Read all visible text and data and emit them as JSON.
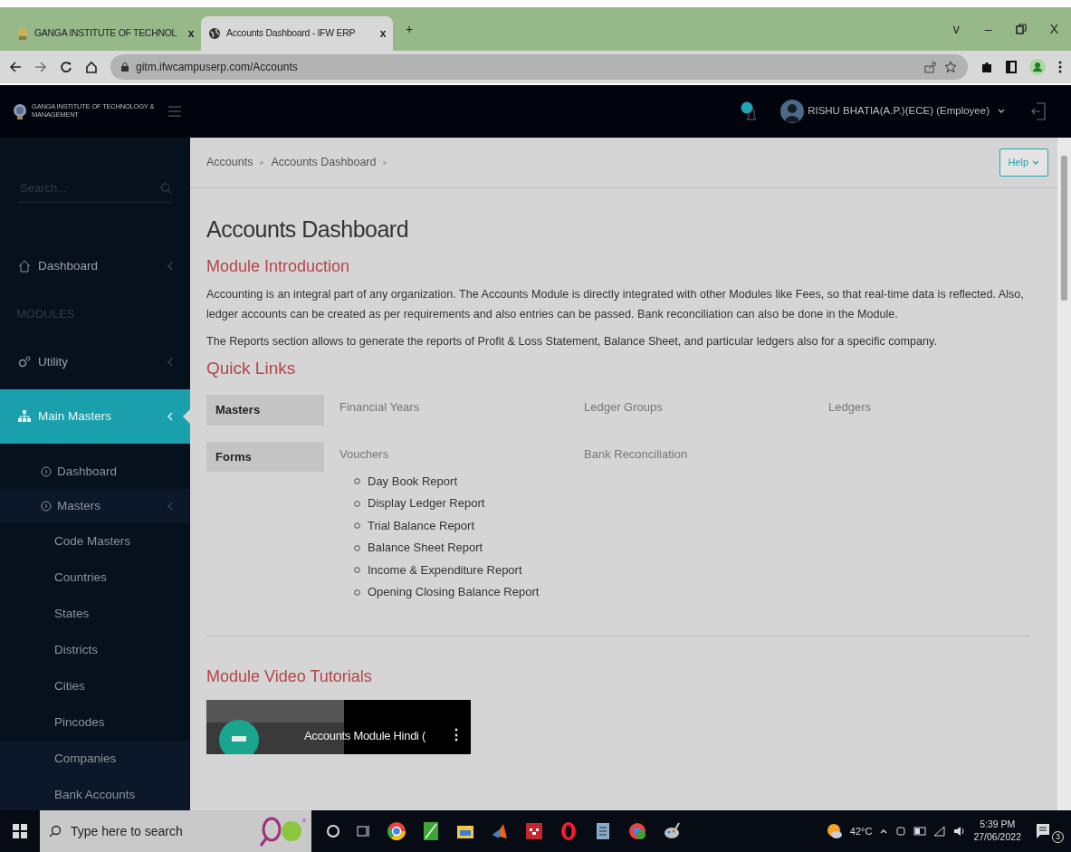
{
  "browser": {
    "tabs": [
      {
        "title": "GANGA INSTITUTE OF TECHNOL",
        "close": "x",
        "selected": false
      },
      {
        "title": "Accounts Dashboard - IFW ERP",
        "close": "x",
        "selected": true
      }
    ],
    "new_tab": "+",
    "window_controls": {
      "menu": "v",
      "minimize": "–",
      "close": "X"
    },
    "url": "gitm.ifwcampuserp.com/Accounts"
  },
  "header": {
    "logo_text": "GANGA INSTITUTE OF TECHNOLOGY & MANAGEMENT",
    "user": "RISHU BHATIA(A.P.)(ECE) (Employee)"
  },
  "sidebar": {
    "search": {
      "placeholder": "Search..."
    },
    "items": [
      {
        "kind": "nav",
        "label": "Dashboard",
        "selected": false
      },
      {
        "kind": "header",
        "label": "MODULES"
      },
      {
        "kind": "nav",
        "label": "Utility",
        "selected": false
      },
      {
        "kind": "nav",
        "label": "Main Masters",
        "selected": true,
        "children": [
          {
            "label": "Dashboard",
            "highlighted": false
          },
          {
            "label": "Masters",
            "highlighted": true,
            "children": [
              {
                "label": "Code Masters",
                "highlighted": false
              },
              {
                "label": "Countries",
                "highlighted": false
              },
              {
                "label": "States",
                "highlighted": false
              },
              {
                "label": "Districts",
                "highlighted": false
              },
              {
                "label": "Cities",
                "highlighted": false
              },
              {
                "label": "Pincodes",
                "highlighted": false
              },
              {
                "label": "Companies",
                "highlighted": true
              },
              {
                "label": "Bank Accounts",
                "highlighted": true
              }
            ]
          }
        ]
      }
    ]
  },
  "breadcrumb": [
    "Accounts",
    "Accounts Dashboard"
  ],
  "help_button": "Help",
  "page_title": "Accounts Dashboard",
  "sections": [
    {
      "heading": "Module Introduction",
      "paragraphs": [
        "Accounting is an integral part of any organization. The Accounts Module is directly integrated with other Modules like Fees, so that real-time data is reflected. Also, ledger accounts can be created as per requirements and also entries can be passed. Bank reconciliation can also be done in the Module.",
        "The Reports section allows to generate the reports of Profit & Loss Statement, Balance Sheet, and particular ledgers also for a specific company."
      ]
    }
  ],
  "quick_links": {
    "heading": "Quick Links",
    "rows": [
      {
        "label": "Masters",
        "links": [
          {
            "label": "Financial Years"
          },
          {
            "label": "Ledger Groups"
          },
          {
            "label": "Ledgers"
          }
        ]
      },
      {
        "label": "Forms",
        "links": [
          {
            "label": "Vouchers",
            "children": [
              "Day Book Report",
              "Display Ledger Report",
              "Trial Balance Report",
              "Balance Sheet Report",
              "Income & Expenditure Report",
              "Opening Closing Balance Report"
            ]
          },
          {
            "label": "Bank Reconciliation"
          }
        ]
      }
    ]
  },
  "video_section": {
    "heading": "Module Video Tutorials",
    "video_title": "Accounts Module Hindi (",
    "menu": "⋮"
  },
  "taskbar": {
    "search_placeholder": "Type here to search",
    "temperature": "42°C",
    "time": "5:39 PM",
    "date": "27/06/2022",
    "notifications": "3"
  }
}
